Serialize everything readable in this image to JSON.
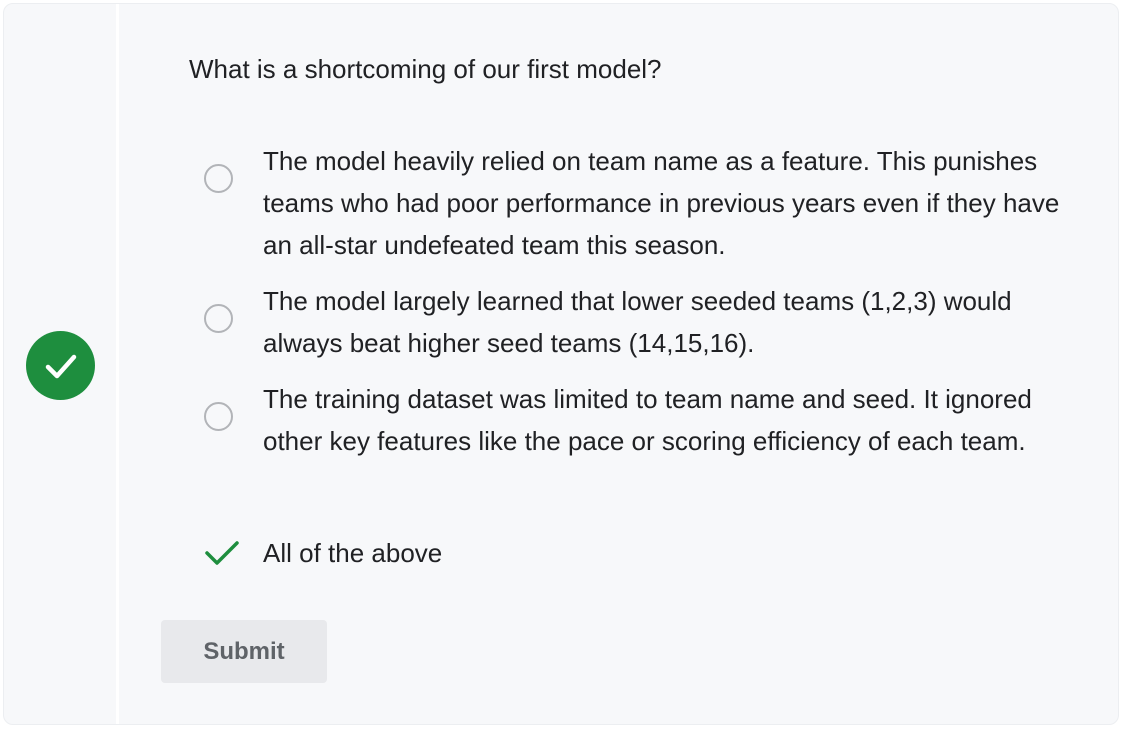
{
  "question": {
    "text": "What is a shortcoming of our first model?",
    "status_icon": "check-circle-icon",
    "status_color": "#1e8e3e",
    "answered_correctly": true
  },
  "options": [
    {
      "label": "The model heavily relied on team name as a feature. This punishes teams who had poor performance in previous years even if they have an all-star undefeated team this season.",
      "state": "unselected"
    },
    {
      "label": "The model largely learned that lower seeded teams (1,2,3) would always beat higher seed teams (14,15,16).",
      "state": "unselected"
    },
    {
      "label": "The training dataset was limited to team name and seed. It ignored other key features like the pace or scoring efficiency of each team.",
      "state": "unselected"
    },
    {
      "label": "All of the above",
      "state": "correct",
      "icon": "checkmark-icon"
    }
  ],
  "actions": {
    "submit_label": "Submit"
  },
  "colors": {
    "card_background": "#f7f8fa",
    "correct_green": "#1e8e3e",
    "radio_border": "#b2b4b8",
    "button_background": "#e8e9ec",
    "button_text": "#5f6368"
  }
}
